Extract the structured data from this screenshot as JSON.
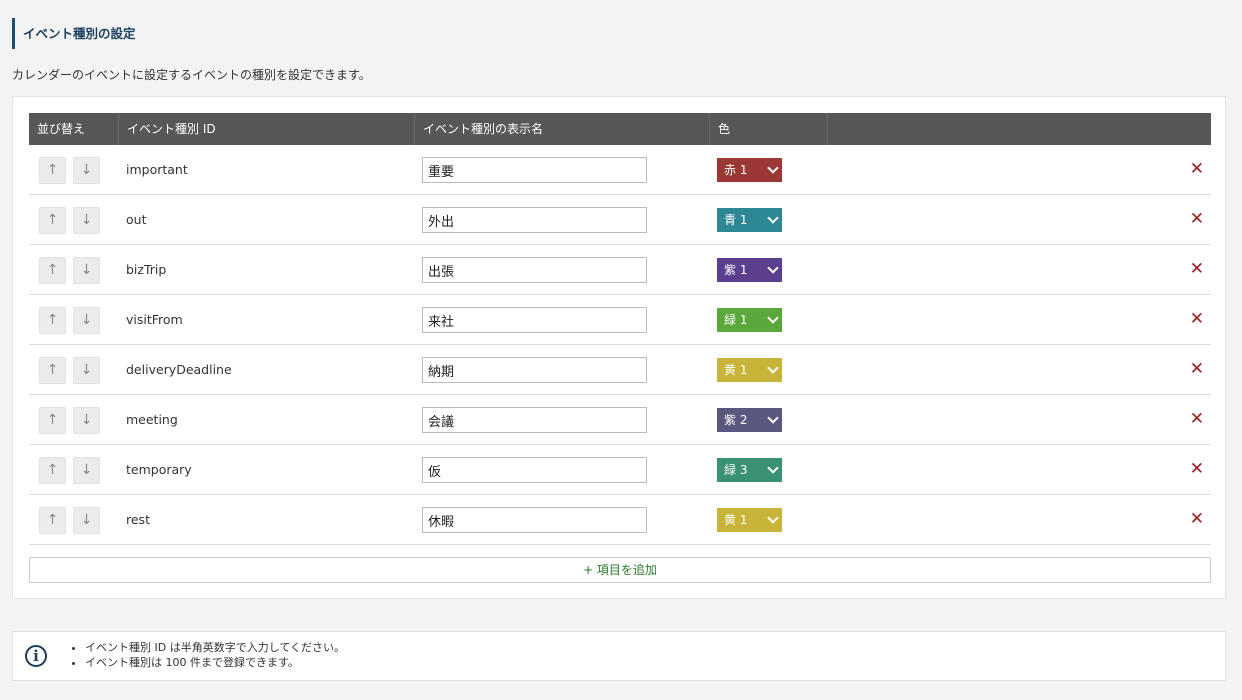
{
  "page": {
    "title": "イベント種別の設定",
    "description": "カレンダーのイベントに設定するイベントの種別を設定できます。"
  },
  "table": {
    "headers": {
      "sort": "並び替え",
      "id": "イベント種別 ID",
      "name": "イベント種別の表示名",
      "color": "色"
    },
    "sort_up_icon": "↑",
    "sort_down_icon": "↓",
    "delete_icon": "✕",
    "rows": [
      {
        "id": "important",
        "name": "重要",
        "color_label": "赤 1",
        "color_hex": "#9b3734"
      },
      {
        "id": "out",
        "name": "外出",
        "color_label": "青 1",
        "color_hex": "#2d8795"
      },
      {
        "id": "bizTrip",
        "name": "出張",
        "color_label": "紫 1",
        "color_hex": "#5b3f8e"
      },
      {
        "id": "visitFrom",
        "name": "来社",
        "color_label": "緑 1",
        "color_hex": "#5aa83b"
      },
      {
        "id": "deliveryDeadline",
        "name": "納期",
        "color_label": "黄 1",
        "color_hex": "#c9b43a"
      },
      {
        "id": "meeting",
        "name": "会議",
        "color_label": "紫 2",
        "color_hex": "#5b5880"
      },
      {
        "id": "temporary",
        "name": "仮",
        "color_label": "緑 3",
        "color_hex": "#3a9173"
      },
      {
        "id": "rest",
        "name": "休暇",
        "color_label": "黄 1",
        "color_hex": "#c9b43a"
      }
    ]
  },
  "add_button": {
    "label": "+ 項目を追加"
  },
  "info": {
    "icon": "i",
    "items": [
      "イベント種別 ID は半角英数字で入力してください。",
      "イベント種別は 100 件まで登録できます。"
    ]
  },
  "colors": {
    "header_bg": "#575757",
    "title_accent": "#1b4e7a",
    "delete": "#a01c1c",
    "add_text": "#2b7a2b"
  }
}
